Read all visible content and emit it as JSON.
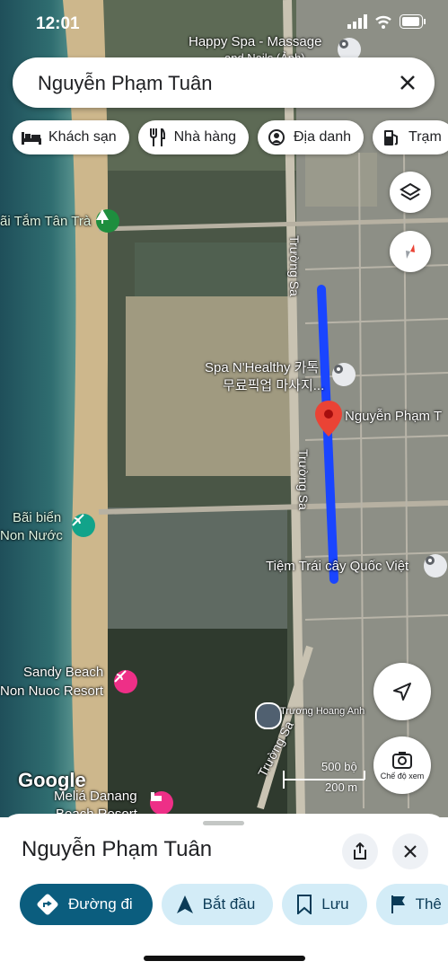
{
  "status": {
    "time": "12:01"
  },
  "search": {
    "query": "Nguyễn Phạm Tuân"
  },
  "chips": [
    {
      "label": "Khách sạn",
      "icon": "bed-icon"
    },
    {
      "label": "Nhà hàng",
      "icon": "fork-knife-icon"
    },
    {
      "label": "Địa danh",
      "icon": "landmark-icon"
    },
    {
      "label": "Trạm",
      "icon": "gas-station-icon"
    }
  ],
  "map": {
    "labels": {
      "happy_spa": "Happy Spa - Massage",
      "happy_spa_sub": "and Nails (Ảnh)",
      "tan_tra": "ãi Tắm Tân Trà",
      "truong_sa_1": "Trường Sa",
      "spa_healthy_1": "Spa N'Healthy 카톡",
      "spa_healthy_2": "무료픽업 마사지...",
      "nguyen_pham": "Nguyễn Phạm T",
      "truong_sa_2": "Trường Sa",
      "bai_bien_1": "Bãi biển",
      "bai_bien_2": "Non Nước",
      "tiem_trai_cay": "Tiệm Trái cây Quốc Việt",
      "sandy_1": "Sandy Beach",
      "sandy_2": "Non Nuoc Resort",
      "truong_hoang_anh": "Trương Hoang Anh",
      "truong_sa_3": "Trường Sa",
      "google": "Google",
      "melia_1": "Meliá Danang",
      "melia_2": "Beach Resort"
    },
    "scale": {
      "ft": "500 bộ",
      "m": "200 m"
    },
    "photo_mode_label": "Chế độ xem",
    "route_color": "#1a45ff",
    "pin_color": "#ea4335"
  },
  "sheet": {
    "title": "Nguyễn Phạm Tuân",
    "actions": [
      {
        "label": "Đường đi",
        "icon": "directions-icon"
      },
      {
        "label": "Bắt đầu",
        "icon": "navigation-arrow-icon"
      },
      {
        "label": "Lưu",
        "icon": "bookmark-icon"
      },
      {
        "label": "Thê",
        "icon": "flag-icon"
      }
    ]
  }
}
